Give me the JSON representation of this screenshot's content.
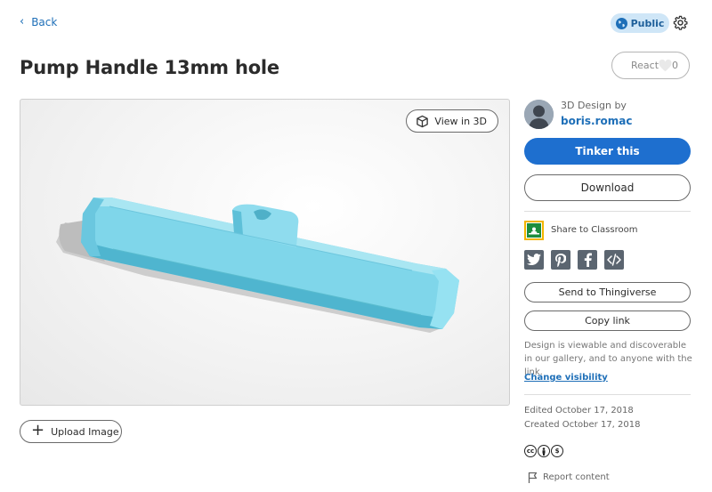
{
  "nav": {
    "back_label": "Back"
  },
  "visibility": {
    "badge_label": "Public"
  },
  "design": {
    "title": "Pump Handle 13mm hole"
  },
  "react": {
    "label": "React",
    "count": "0"
  },
  "viewer": {
    "view3d_label": "View in 3D",
    "model_color": "#7fd6ea"
  },
  "upload": {
    "label": "Upload Image"
  },
  "author": {
    "design_by": "3D Design by",
    "name": "boris.romac"
  },
  "actions": {
    "tinker_label": "Tinker this",
    "download_label": "Download"
  },
  "share": {
    "classroom_label": "Share to Classroom",
    "social_icons": [
      "twitter-icon",
      "pinterest-icon",
      "facebook-icon",
      "embed-code-icon"
    ],
    "thingiverse_label": "Send to Thingiverse",
    "copy_link_label": "Copy link"
  },
  "visibility_info": {
    "note": "Design is viewable and discoverable in our gallery, and to anyone with the link.",
    "change_label": "Change visibility"
  },
  "dates": {
    "edited": "Edited October 17, 2018",
    "created": "Created October 17, 2018"
  },
  "license": {
    "icons": [
      "cc",
      "by",
      "nc"
    ]
  },
  "report": {
    "label": "Report content"
  },
  "colors": {
    "accent": "#1e6fcf",
    "link": "#1e6fb8",
    "badge_bg": "#cfe6f7"
  }
}
